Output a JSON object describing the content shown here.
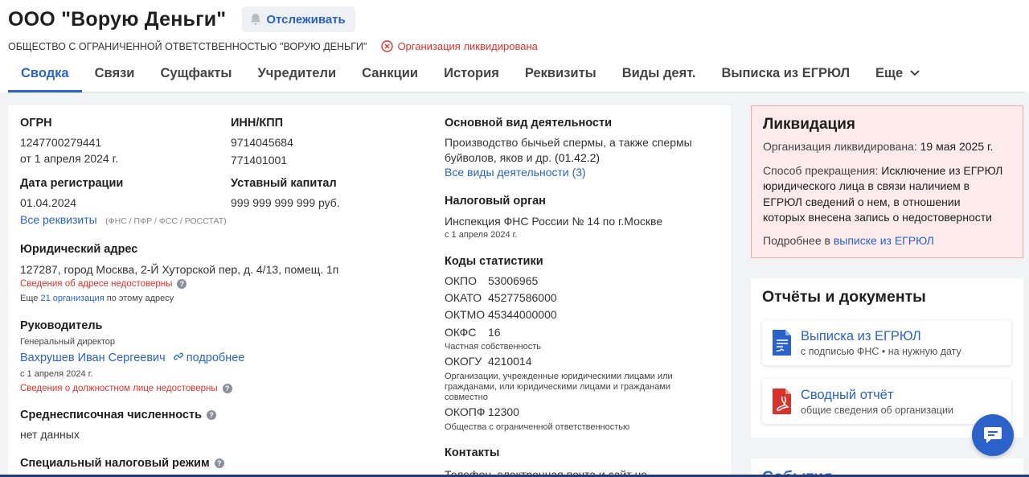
{
  "header": {
    "title": "ООО \"Ворую Деньги\"",
    "track_label": "Отслеживать",
    "full_name": "ОБЩЕСТВО С ОГРАНИЧЕННОЙ ОТВЕТСТВЕННОСТЬЮ \"ВОРУЮ ДЕНЬГИ\"",
    "status": "Организация ликвидирована"
  },
  "tabs": [
    {
      "label": "Сводка",
      "active": true
    },
    {
      "label": "Связи"
    },
    {
      "label": "Сущфакты"
    },
    {
      "label": "Учредители"
    },
    {
      "label": "Санкции"
    },
    {
      "label": "История"
    },
    {
      "label": "Реквизиты"
    },
    {
      "label": "Виды деят."
    },
    {
      "label": "Выписка из ЕГРЮЛ"
    },
    {
      "label": "Еще"
    }
  ],
  "main": {
    "ogrn": {
      "label": "ОГРН",
      "value": "1247700279441",
      "date": "от 1 апреля 2024 г."
    },
    "inn": {
      "label": "ИНН/КПП",
      "inn": "9714045684",
      "kpp": "771401001"
    },
    "reg": {
      "label": "Дата регистрации",
      "value": "01.04.2024"
    },
    "capital": {
      "label": "Уставный капитал",
      "value": "999 999 999 999 руб."
    },
    "all_requisites": {
      "link": "Все реквизиты",
      "note": "(ФНС / ПФР / ФСС / РОССТАТ)"
    },
    "address": {
      "label": "Юридический адрес",
      "value": "127287, город Москва, 2-Й Хуторской пер, д. 4/13, помещ. 1п",
      "warning": "Сведения об адресе недостоверны",
      "more_prefix": "Еще",
      "more_link": "21 организация",
      "more_suffix": "по этому адресу"
    },
    "director": {
      "label": "Руководитель",
      "position": "Генеральный директор",
      "name": "Вахрушев Иван Сергеевич",
      "more": "подробнее",
      "date": "с 1 апреля 2024 г.",
      "warning": "Сведения о должностном лице недостоверны"
    },
    "headcount": {
      "label": "Среднесписочная численность",
      "value": "нет данных"
    },
    "tax_regime": {
      "label": "Специальный налоговый режим"
    },
    "activity": {
      "label": "Основной вид деятельности",
      "value_line1": "Производство бычьей спермы, а также спермы",
      "value_line2": "буйволов, яков и др.",
      "code": "(01.42.2)",
      "all_link": "Все виды деятельности (3)"
    },
    "tax_office": {
      "label": "Налоговый орган",
      "value": "Инспекция ФНС России № 14 по г.Москве",
      "date": "с 1 апреля 2024 г."
    },
    "stats": {
      "label": "Коды статистики",
      "okpo": {
        "k": "ОКПО",
        "v": "53006965"
      },
      "okato": {
        "k": "ОКАТО",
        "v": "45277586000"
      },
      "oktmo": {
        "k": "ОКТМО",
        "v": "45344000000"
      },
      "okfs": {
        "k": "ОКФС",
        "v": "16",
        "desc": "Частная собственность"
      },
      "okogu": {
        "k": "ОКОГУ",
        "v": "4210014",
        "desc1": "Организации, учрежденные юридическими лицами или",
        "desc2": "гражданами, или юридическими лицами и гражданами",
        "desc3": "совместно"
      },
      "okopf": {
        "k": "ОКОПФ",
        "v": "12300",
        "desc": "Общества с ограниченной ответственностью"
      }
    },
    "contacts": {
      "label": "Контакты",
      "value": "Телефон, электронная почта и сайт не"
    }
  },
  "liquidation": {
    "title": "Ликвидация",
    "date_prefix": "Организация ликвидирована:",
    "date": "19 мая 2025 г.",
    "method_prefix": "Способ прекращения:",
    "method_l1": "Исключение из ЕГРЮЛ",
    "method_l2": "юридического лица в связи наличием в",
    "method_l3": "ЕГРЮЛ сведений о нем, в отношении",
    "method_l4": "которых внесена запись о недостоверности",
    "more_prefix": "Подробнее в",
    "more_link": "выписке из ЕГРЮЛ"
  },
  "docs": {
    "title": "Отчёты и документы",
    "items": [
      {
        "title": "Выписка из ЕГРЮЛ",
        "sub": "с подписью ФНС • на нужную дату"
      },
      {
        "title": "Сводный отчёт",
        "sub": "общие сведения об организации"
      }
    ]
  },
  "events": {
    "title": "События"
  },
  "colors": {
    "accent": "#2a62c9",
    "danger": "#e0322c",
    "liq_bg": "#fdeaea"
  }
}
